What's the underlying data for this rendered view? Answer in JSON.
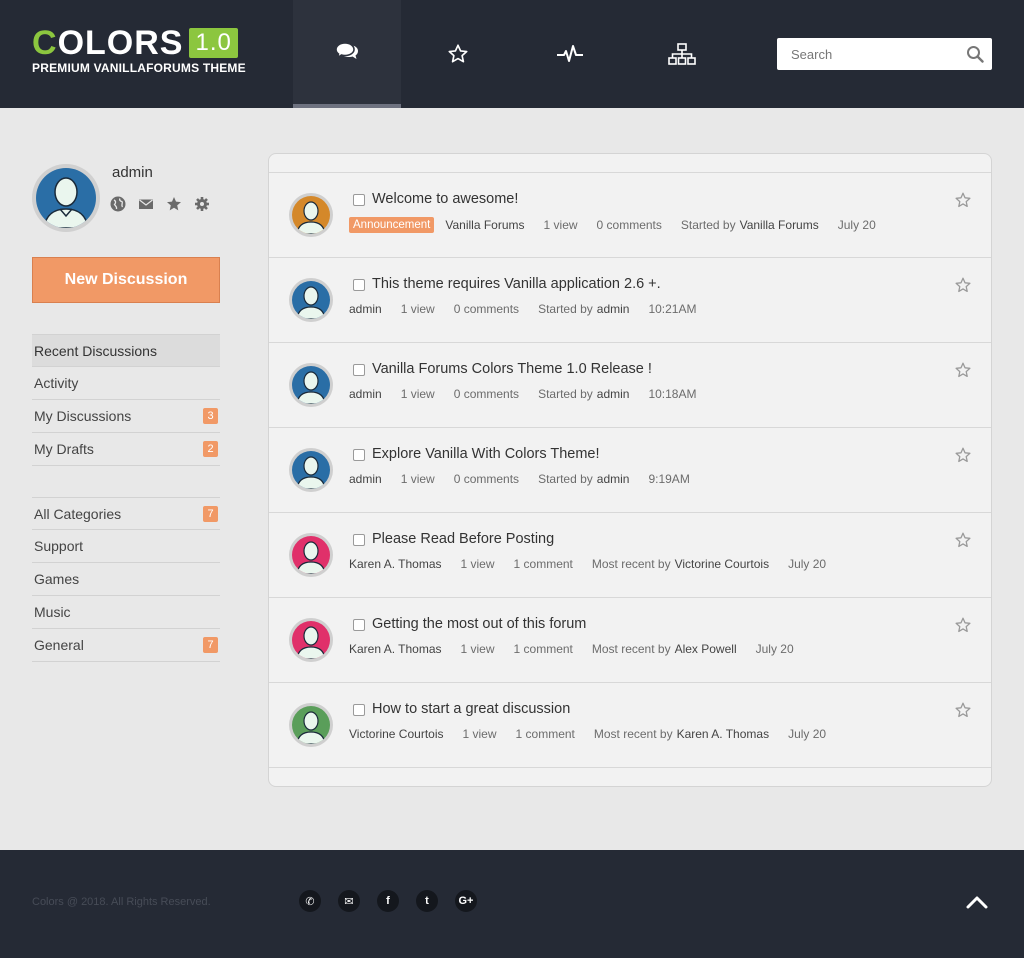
{
  "logo": {
    "letter_c": "C",
    "word_rest": "OLORS",
    "version": "1.0",
    "subtitle": "PREMIUM VANILLAFORUMS THEME"
  },
  "nav": [
    {
      "name": "discussions-tab",
      "icon": "chat-bubbles-icon",
      "active": true
    },
    {
      "name": "bookmarks-tab",
      "icon": "star-icon",
      "active": false
    },
    {
      "name": "activity-tab",
      "icon": "pulse-icon",
      "active": false
    },
    {
      "name": "categories-tab",
      "icon": "sitemap-icon",
      "active": false
    }
  ],
  "search": {
    "placeholder": "Search",
    "icon": "search-icon"
  },
  "user": {
    "name": "admin",
    "icons": [
      "globe-icon",
      "mail-icon",
      "star-icon",
      "gear-icon"
    ]
  },
  "new_discussion": "New Discussion",
  "menu1": [
    {
      "label": "Recent Discussions",
      "badge": "",
      "active": true
    },
    {
      "label": "Activity",
      "badge": ""
    },
    {
      "label": "My Discussions",
      "badge": "3"
    },
    {
      "label": "My Drafts",
      "badge": "2"
    }
  ],
  "menu2": [
    {
      "label": "All Categories",
      "badge": "7"
    },
    {
      "label": "Support",
      "badge": ""
    },
    {
      "label": "Games",
      "badge": ""
    },
    {
      "label": "Music",
      "badge": ""
    },
    {
      "label": "General",
      "badge": "7"
    }
  ],
  "discussions": [
    {
      "title": "Welcome to awesome!",
      "tag": "Announcement",
      "author": "Vanilla Forums",
      "views": "1 view",
      "comments": "0 comments",
      "last_prefix": "Started by",
      "last_user": "Vanilla Forums",
      "date": "July 20",
      "avatar_color": "#d4882a"
    },
    {
      "title": "This theme requires Vanilla application 2.6 +.",
      "tag": "",
      "author": "admin",
      "views": "1 view",
      "comments": "0 comments",
      "last_prefix": "Started by",
      "last_user": "admin",
      "date": "10:21AM",
      "avatar_color": "#2a6ea6"
    },
    {
      "title": "Vanilla Forums Colors Theme 1.0 Release !",
      "tag": "",
      "author": "admin",
      "views": "1 view",
      "comments": "0 comments",
      "last_prefix": "Started by",
      "last_user": "admin",
      "date": "10:18AM",
      "avatar_color": "#2a6ea6"
    },
    {
      "title": "Explore Vanilla With Colors Theme!",
      "tag": "",
      "author": "admin",
      "views": "1 view",
      "comments": "0 comments",
      "last_prefix": "Started by",
      "last_user": "admin",
      "date": "9:19AM",
      "avatar_color": "#2a6ea6"
    },
    {
      "title": "Please Read Before Posting",
      "tag": "",
      "author": "Karen A. Thomas",
      "views": "1 view",
      "comments": "1 comment",
      "last_prefix": "Most recent by",
      "last_user": "Victorine Courtois",
      "date": "July 20",
      "avatar_color": "#e0306a"
    },
    {
      "title": "Getting the most out of this forum",
      "tag": "",
      "author": "Karen A. Thomas",
      "views": "1 view",
      "comments": "1 comment",
      "last_prefix": "Most recent by",
      "last_user": "Alex Powell",
      "date": "July 20",
      "avatar_color": "#e0306a"
    },
    {
      "title": "How to start a great discussion",
      "tag": "",
      "author": "Victorine Courtois",
      "views": "1 view",
      "comments": "1 comment",
      "last_prefix": "Most recent by",
      "last_user": "Karen A. Thomas",
      "date": "July 20",
      "avatar_color": "#5a9e5a"
    }
  ],
  "footer": {
    "copyright": "Colors @ 2018. All Rights Reserved.",
    "socials": [
      {
        "name": "phone-icon",
        "glyph": "✆"
      },
      {
        "name": "mail-icon",
        "glyph": "✉"
      },
      {
        "name": "facebook-icon",
        "glyph": "f"
      },
      {
        "name": "twitter-icon",
        "glyph": "t"
      },
      {
        "name": "google-plus-icon",
        "glyph": "G+"
      }
    ]
  },
  "colors": {
    "header_bg": "#252a35",
    "accent_orange": "#f19966",
    "logo_green": "#8cc63f"
  }
}
